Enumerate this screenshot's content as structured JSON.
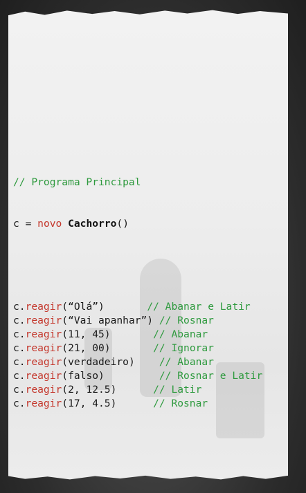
{
  "code": {
    "header_comment": "// Programa Principal",
    "assignment": {
      "var": "c",
      "eq": " = ",
      "keyword": "novo",
      "space": " ",
      "class_name": "Cachorro",
      "parens": "()"
    },
    "calls": [
      {
        "obj": "c.",
        "method": "reagir",
        "args": "(“Olá”)",
        "pad": "       ",
        "comment": "// Abanar e Latir"
      },
      {
        "obj": "c.",
        "method": "reagir",
        "args": "(“Vai apanhar”)",
        "pad": " ",
        "comment": "// Rosnar"
      },
      {
        "obj": "c.",
        "method": "reagir",
        "args": "(11, 45)",
        "pad": "       ",
        "comment": "// Abanar"
      },
      {
        "obj": "c.",
        "method": "reagir",
        "args": "(21, 00)",
        "pad": "       ",
        "comment": "// Ignorar"
      },
      {
        "obj": "c.",
        "method": "reagir",
        "args": "(verdadeiro)",
        "pad": "    ",
        "comment": "// Abanar"
      },
      {
        "obj": "c.",
        "method": "reagir",
        "args": "(falso)",
        "pad": "         ",
        "comment": "// Rosnar e Latir"
      },
      {
        "obj": "c.",
        "method": "reagir",
        "args": "(2, 12.5)",
        "pad": "      ",
        "comment": "// Latir"
      },
      {
        "obj": "c.",
        "method": "reagir",
        "args": "(17, 4.5)",
        "pad": "      ",
        "comment": "// Rosnar"
      }
    ]
  },
  "colors": {
    "comment": "#2e9a3e",
    "method": "#c4362b",
    "keyword": "#c4362b",
    "text": "#1a1a1a"
  }
}
